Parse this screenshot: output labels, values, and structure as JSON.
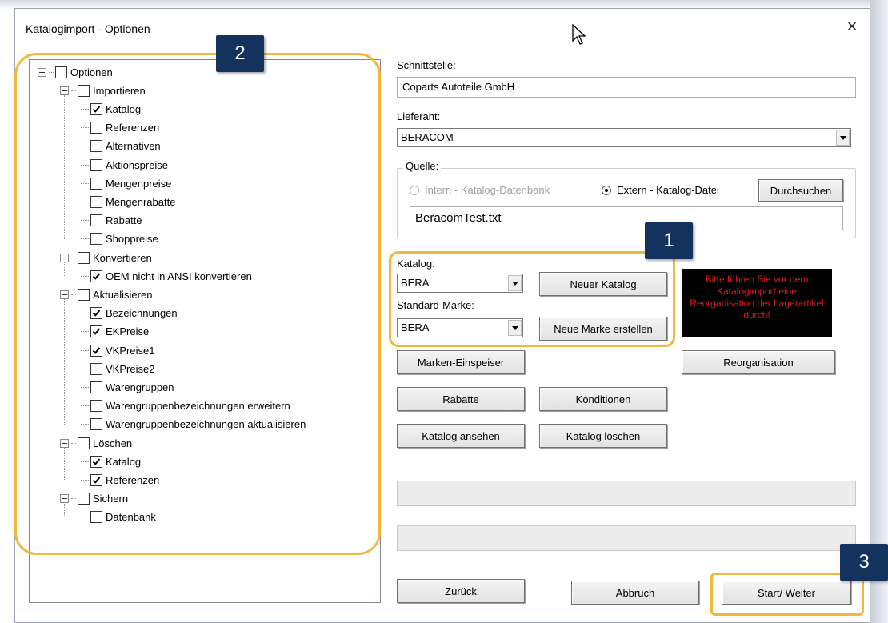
{
  "window": {
    "title": "Katalogimport - Optionen",
    "close_glyph": "×"
  },
  "tree": {
    "items": [
      {
        "label": "Optionen",
        "checked": false,
        "level": 0,
        "expander": true
      },
      {
        "label": "Importieren",
        "checked": false,
        "level": 1,
        "expander": true
      },
      {
        "label": "Katalog",
        "checked": true,
        "level": 2
      },
      {
        "label": "Referenzen",
        "checked": false,
        "level": 2
      },
      {
        "label": "Alternativen",
        "checked": false,
        "level": 2
      },
      {
        "label": "Aktionspreise",
        "checked": false,
        "level": 2
      },
      {
        "label": "Mengenpreise",
        "checked": false,
        "level": 2
      },
      {
        "label": "Mengenrabatte",
        "checked": false,
        "level": 2
      },
      {
        "label": "Rabatte",
        "checked": false,
        "level": 2
      },
      {
        "label": "Shoppreise",
        "checked": false,
        "level": 2
      },
      {
        "label": "Konvertieren",
        "checked": false,
        "level": 1,
        "expander": true
      },
      {
        "label": "OEM nicht in ANSI konvertieren",
        "checked": true,
        "level": 2
      },
      {
        "label": "Aktualisieren",
        "checked": false,
        "level": 1,
        "expander": true
      },
      {
        "label": "Bezeichnungen",
        "checked": true,
        "level": 2
      },
      {
        "label": "EKPreise",
        "checked": true,
        "level": 2
      },
      {
        "label": "VKPreise1",
        "checked": true,
        "level": 2
      },
      {
        "label": "VKPreise2",
        "checked": false,
        "level": 2
      },
      {
        "label": "Warengruppen",
        "checked": false,
        "level": 2
      },
      {
        "label": "Warengruppenbezeichnungen erweitern",
        "checked": false,
        "level": 2
      },
      {
        "label": "Warengruppenbezeichnungen aktualisieren",
        "checked": false,
        "level": 2
      },
      {
        "label": "Löschen",
        "checked": false,
        "level": 1,
        "expander": true
      },
      {
        "label": "Katalog",
        "checked": true,
        "level": 2
      },
      {
        "label": "Referenzen",
        "checked": true,
        "level": 2
      },
      {
        "label": "Sichern",
        "checked": false,
        "level": 1,
        "expander": true
      },
      {
        "label": "Datenbank",
        "checked": false,
        "level": 2
      }
    ]
  },
  "form": {
    "schnittstelle_label": "Schnittstelle:",
    "schnittstelle_value": "Coparts Autoteile GmbH",
    "lieferant_label": "Lieferant:",
    "lieferant_value": "BERACOM",
    "quelle_label": "Quelle:",
    "radio_intern": "Intern - Katalog-Datenbank",
    "radio_extern": "Extern - Katalog-Datei",
    "durchsuchen": "Durchsuchen",
    "file_value": "BeracomTest.txt",
    "katalog_label": "Katalog:",
    "katalog_value": "BERA",
    "neuer_katalog": "Neuer Katalog",
    "standard_marke_label": "Standard-Marke:",
    "standard_marke_value": "BERA",
    "neue_marke": "Neue Marke erstellen",
    "warning": "Bitte führen Sie vor dem Katalogimport eine Reorganisation der Lagerartikel durch!",
    "marken_einspeiser": "Marken-Einspeiser",
    "reorganisation": "Reorganisation",
    "rabatte": "Rabatte",
    "konditionen": "Konditionen",
    "katalog_ansehen": "Katalog ansehen",
    "katalog_loeschen": "Katalog löschen"
  },
  "footer": {
    "zurueck": "Zurück",
    "abbruch": "Abbruch",
    "start": "Start/ Weiter"
  },
  "annotations": {
    "badge1": "1",
    "badge2": "2",
    "badge3": "3"
  },
  "colors": {
    "annotation_ring": "#f1b83c",
    "badge_bg": "#13335e",
    "warning_text": "#e01b1b"
  }
}
